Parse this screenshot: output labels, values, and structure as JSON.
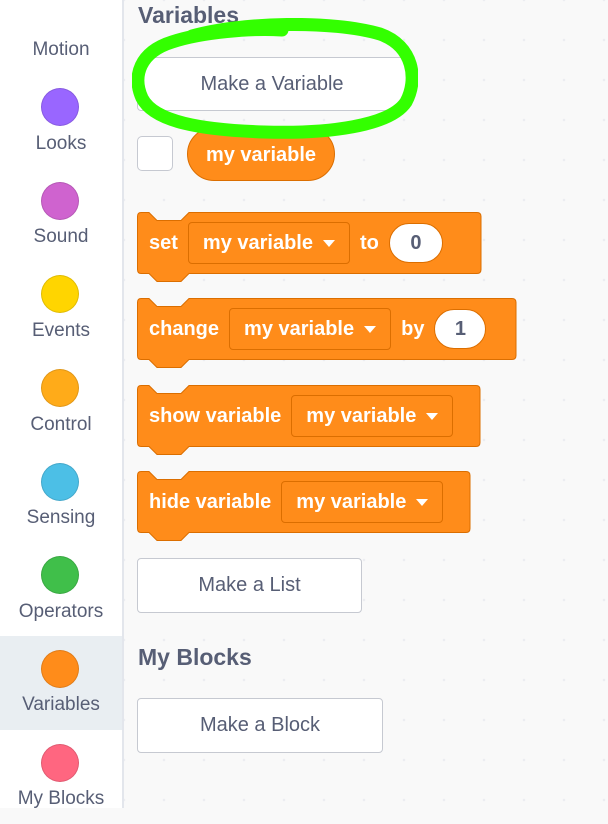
{
  "colors": {
    "motion": "#4c97ff",
    "looks": "#9966ff",
    "sound": "#cf63cf",
    "events": "#ffd500",
    "control": "#ffab19",
    "sensing": "#4cbfe6",
    "operators": "#40bf4a",
    "variables": "#ff8c1a",
    "my_blocks": "#ff6680",
    "highlight": "#33ff00"
  },
  "categories": [
    {
      "label": "Motion",
      "color": "#4c97ff"
    },
    {
      "label": "Looks",
      "color": "#9966ff"
    },
    {
      "label": "Sound",
      "color": "#cf63cf"
    },
    {
      "label": "Events",
      "color": "#ffd500"
    },
    {
      "label": "Control",
      "color": "#ffab19"
    },
    {
      "label": "Sensing",
      "color": "#4cbfe6"
    },
    {
      "label": "Operators",
      "color": "#40bf4a"
    },
    {
      "label": "Variables",
      "color": "#ff8c1a",
      "selected": true
    },
    {
      "label": "My Blocks",
      "color": "#ff6680"
    }
  ],
  "palette": {
    "variables_heading": "Variables",
    "make_variable": "Make a Variable",
    "variable_reporter": "my variable",
    "blocks": {
      "set": {
        "label": "set",
        "variable": "my variable",
        "connector": "to",
        "value": "0"
      },
      "change": {
        "label": "change",
        "variable": "my variable",
        "connector": "by",
        "value": "1"
      },
      "show": {
        "label": "show variable",
        "variable": "my variable"
      },
      "hide": {
        "label": "hide variable",
        "variable": "my variable"
      }
    },
    "make_list": "Make a List",
    "my_blocks_heading": "My Blocks",
    "make_block": "Make a Block"
  }
}
